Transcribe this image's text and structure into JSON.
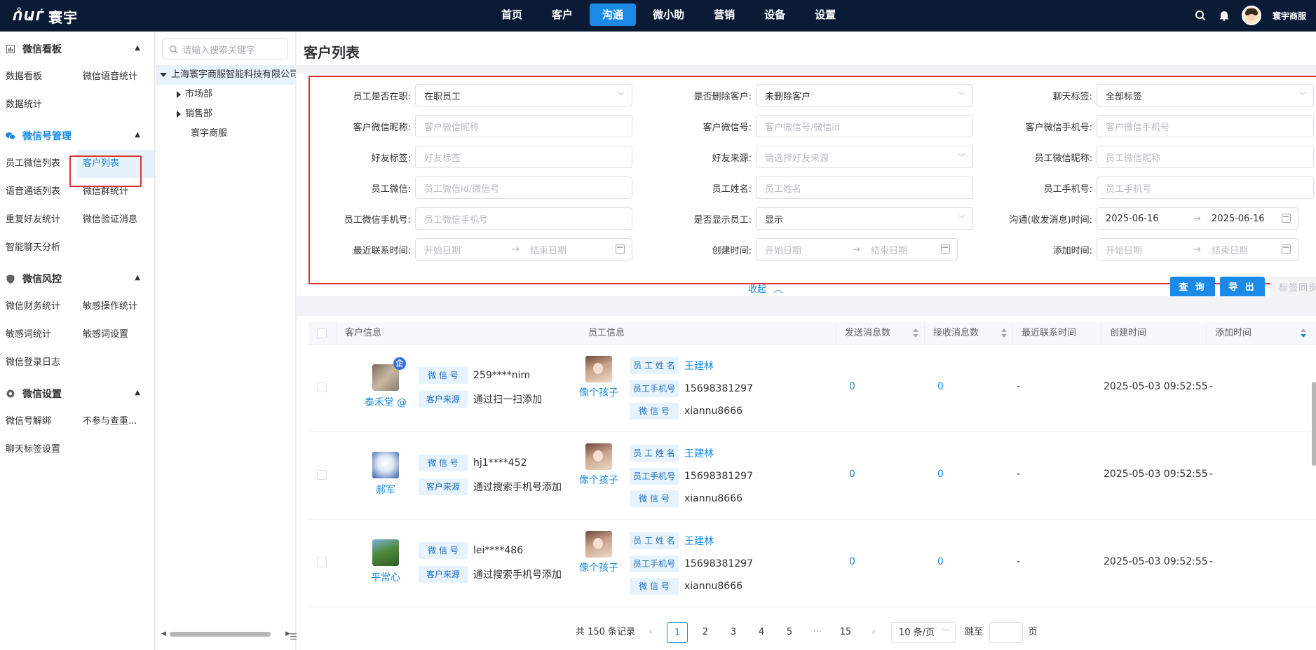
{
  "brand": {
    "name": "寰宇"
  },
  "nav": {
    "items": [
      "首页",
      "客户",
      "沟通",
      "微小助",
      "营销",
      "设备",
      "设置"
    ],
    "active_index": 2
  },
  "user": {
    "name": "寰宇商服"
  },
  "sidebar": {
    "groups": [
      {
        "title": "微信看板",
        "icon": "chart-icon",
        "items": [
          "数据看板",
          "微信语音统计",
          "数据统计"
        ]
      },
      {
        "title": "微信号管理",
        "icon": "wechat-icon",
        "items": [
          "员工微信列表",
          "客户列表",
          "语音通话列表",
          "微信群统计",
          "重复好友统计",
          "微信验证消息",
          "智能聊天分析"
        ]
      },
      {
        "title": "微信风控",
        "icon": "shield-icon",
        "items": [
          "微信财务统计",
          "敏感操作统计",
          "敏感词统计",
          "敏感词设置",
          "微信登录日志"
        ]
      },
      {
        "title": "微信设置",
        "icon": "gear-icon",
        "items": [
          "微信号解绑",
          "不参与查重...",
          "聊天标签设置"
        ]
      }
    ],
    "active_item": "客户列表"
  },
  "tree": {
    "search_placeholder": "请输入搜索关键字",
    "root": "上海寰宇商服智能科技有限公司",
    "children": [
      "市场部",
      "销售部",
      "寰宇商服"
    ]
  },
  "page": {
    "title": "客户列表"
  },
  "filters": {
    "rows": [
      [
        {
          "label": "员工是否在职:",
          "value": "在职员工",
          "type": "select"
        },
        {
          "label": "是否删除客户:",
          "value": "未删除客户",
          "type": "select"
        },
        {
          "label": "聊天标签:",
          "value": "全部标签",
          "type": "select"
        }
      ],
      [
        {
          "label": "客户微信昵称:",
          "placeholder": "客户微信昵称",
          "type": "input"
        },
        {
          "label": "客户微信号:",
          "placeholder": "客户微信号/微信id",
          "type": "input"
        },
        {
          "label": "客户微信手机号:",
          "placeholder": "客户微信手机号",
          "type": "input"
        }
      ],
      [
        {
          "label": "好友标签:",
          "placeholder": "好友标签",
          "type": "input"
        },
        {
          "label": "好友来源:",
          "placeholder": "请选择好友来源",
          "type": "select"
        },
        {
          "label": "员工微信昵称:",
          "placeholder": "员工微信昵称",
          "type": "input"
        }
      ],
      [
        {
          "label": "员工微信:",
          "placeholder": "员工微信id/微信号",
          "type": "input"
        },
        {
          "label": "员工姓名:",
          "placeholder": "员工姓名",
          "type": "input"
        },
        {
          "label": "员工手机号:",
          "placeholder": "员工手机号",
          "type": "input"
        }
      ],
      [
        {
          "label": "员工微信手机号:",
          "placeholder": "员工微信手机号",
          "type": "input"
        },
        {
          "label": "是否显示员工:",
          "value": "显示",
          "type": "select"
        },
        {
          "label": "沟通(收发消息)时间:",
          "start": "2025-06-16",
          "end": "2025-06-16",
          "type": "daterange"
        }
      ],
      [
        {
          "label": "最近联系时间:",
          "start_placeholder": "开始日期",
          "end_placeholder": "结束日期",
          "type": "daterange"
        },
        {
          "label": "创建时间:",
          "start_placeholder": "开始日期",
          "end_placeholder": "结束日期",
          "type": "daterange"
        },
        {
          "label": "添加时间:",
          "start_placeholder": "开始日期",
          "end_placeholder": "结束日期",
          "type": "daterange"
        }
      ]
    ],
    "collapse_label": "收起",
    "query_label": "查 询",
    "export_label": "导 出",
    "tag_sync_label": "标签同步"
  },
  "table": {
    "columns": [
      "客户信息",
      "员工信息",
      "发送消息数",
      "接收消息数",
      "最近联系时间",
      "创建时间",
      "添加时间"
    ],
    "field_labels": {
      "wechat_id": "微 信 号",
      "source": "客户来源",
      "emp_name": "员 工 姓 名",
      "emp_phone": "员工手机号",
      "emp_wechat": "微 信 号"
    },
    "rows": [
      {
        "customer_name": "泰禾堂 @",
        "enterprise_badge": "企",
        "wechat_id": "259****nim",
        "source": "通过扫一扫添加",
        "employee_nick": "像个孩子",
        "emp_name": "王建林",
        "emp_phone": "15698381297",
        "emp_wechat": "xiannu8666",
        "sent": "0",
        "received": "0",
        "last_contact": "-",
        "created": "2025-05-03 09:52:55",
        "added": "-"
      },
      {
        "customer_name": "郝军",
        "wechat_id": "hj1****452",
        "source": "通过搜索手机号添加",
        "employee_nick": "像个孩子",
        "emp_name": "王建林",
        "emp_phone": "15698381297",
        "emp_wechat": "xiannu8666",
        "sent": "0",
        "received": "0",
        "last_contact": "-",
        "created": "2025-05-03 09:52:55",
        "added": "-"
      },
      {
        "customer_name": "平常心",
        "wechat_id": "lei****486",
        "source": "通过搜索手机号添加",
        "employee_nick": "像个孩子",
        "emp_name": "王建林",
        "emp_phone": "15698381297",
        "emp_wechat": "xiannu8666",
        "sent": "0",
        "received": "0",
        "last_contact": "-",
        "created": "2025-05-03 09:52:55",
        "added": "-"
      }
    ]
  },
  "pagination": {
    "total_text": "共 150 条记录",
    "pages": [
      "1",
      "2",
      "3",
      "4",
      "5",
      "···",
      "15"
    ],
    "current": "1",
    "page_size": "10 条/页",
    "jump_label": "跳至",
    "page_suffix": "页"
  },
  "colors": {
    "primary": "#1a8ae6",
    "topbar": "#0b1b36",
    "highlight_border": "#e03131"
  }
}
